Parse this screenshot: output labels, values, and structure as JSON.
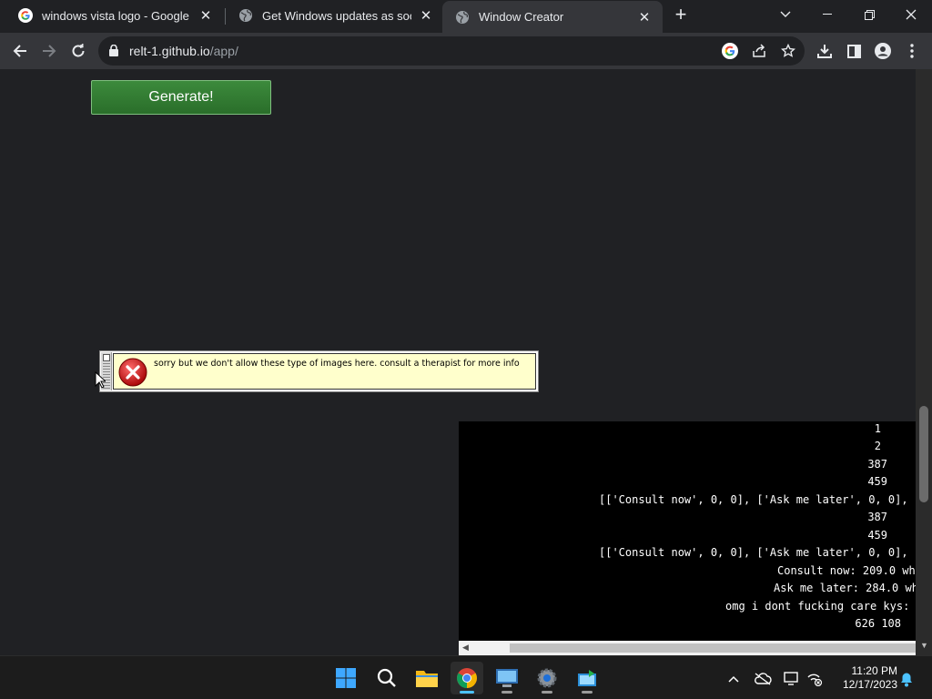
{
  "browser": {
    "tabs": [
      {
        "title": "windows vista logo - Google Sea",
        "icon": "google-icon"
      },
      {
        "title": "Get Windows updates as soon as",
        "icon": "globe-icon"
      },
      {
        "title": "Window Creator",
        "icon": "globe-icon",
        "active": true
      }
    ],
    "close_glyph": "✕",
    "new_tab_glyph": "+",
    "url_host": "relt-1.github.io",
    "url_path": "/app/"
  },
  "page": {
    "generate_label": "Generate!",
    "error_dialog": {
      "message": "sorry but we don't allow these type of images here. consult a therapist for more info",
      "icon": "error-x-icon"
    },
    "console_lines": [
      "1",
      "2",
      "387",
      "459",
      "[['Consult now', 0, 0], ['Ask me later', 0, 0], [",
      "387",
      "459",
      "[['Consult now', 0, 0], ['Ask me later', 0, 0], [",
      "Consult now: 209.0 wh",
      "Ask me later: 284.0 wh",
      "omg i dont fucking care kys: ",
      "626 108"
    ]
  },
  "taskbar": {
    "apps": [
      "windows-start-icon",
      "search-icon",
      "file-explorer-icon",
      "chrome-icon",
      "remote-desktop-icon",
      "settings-icon",
      "app-icon"
    ],
    "time": "11:20 PM",
    "date": "12/17/2023"
  },
  "colors": {
    "accent_green": "#2f7d32",
    "dialog_background": "#ffffcc",
    "taskbar_active": "#4cc2ff"
  }
}
